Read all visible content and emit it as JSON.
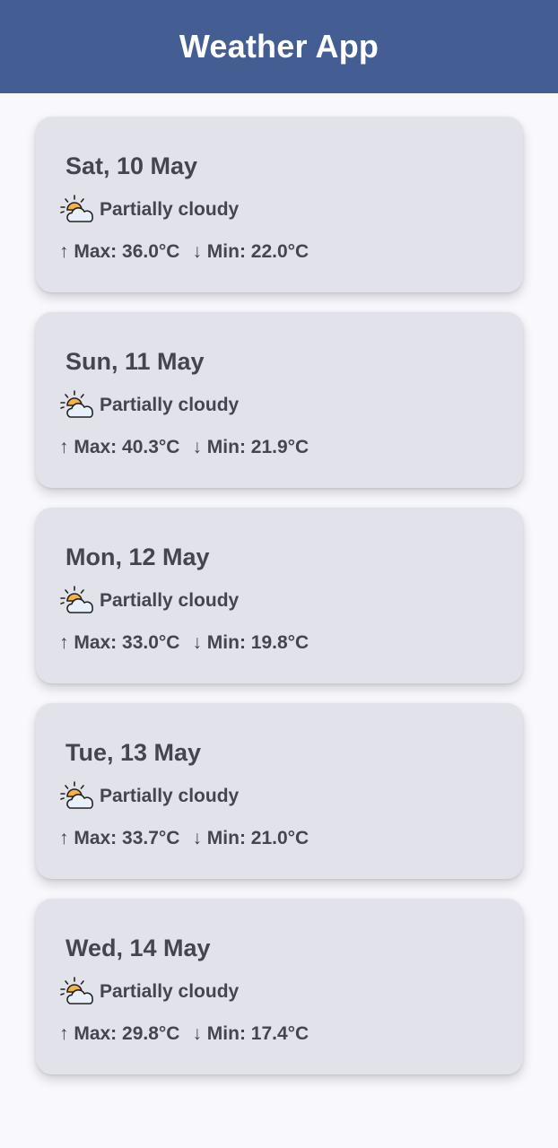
{
  "app_bar": {
    "title": "Weather App"
  },
  "forecast": [
    {
      "date": "Sat, 10 May",
      "condition": "Partially cloudy",
      "icon": "partly-cloudy-icon",
      "max": "↑ Max: 36.0°C",
      "min": "↓ Min: 22.0°C"
    },
    {
      "date": "Sun, 11 May",
      "condition": "Partially cloudy",
      "icon": "partly-cloudy-icon",
      "max": "↑ Max: 40.3°C",
      "min": "↓ Min: 21.9°C"
    },
    {
      "date": "Mon, 12 May",
      "condition": "Partially cloudy",
      "icon": "partly-cloudy-icon",
      "max": "↑ Max: 33.0°C",
      "min": "↓ Min: 19.8°C"
    },
    {
      "date": "Tue, 13 May",
      "condition": "Partially cloudy",
      "icon": "partly-cloudy-icon",
      "max": "↑ Max: 33.7°C",
      "min": "↓ Min: 21.0°C"
    },
    {
      "date": "Wed, 14 May",
      "condition": "Partially cloudy",
      "icon": "partly-cloudy-icon",
      "max": "↑ Max: 29.8°C",
      "min": "↓ Min: 17.4°C"
    }
  ],
  "colors": {
    "app_bar": "#445e94",
    "background": "#f8f8fd",
    "card": "#e2e2ea",
    "text": "#44464f",
    "sun": "#f3b34a"
  }
}
